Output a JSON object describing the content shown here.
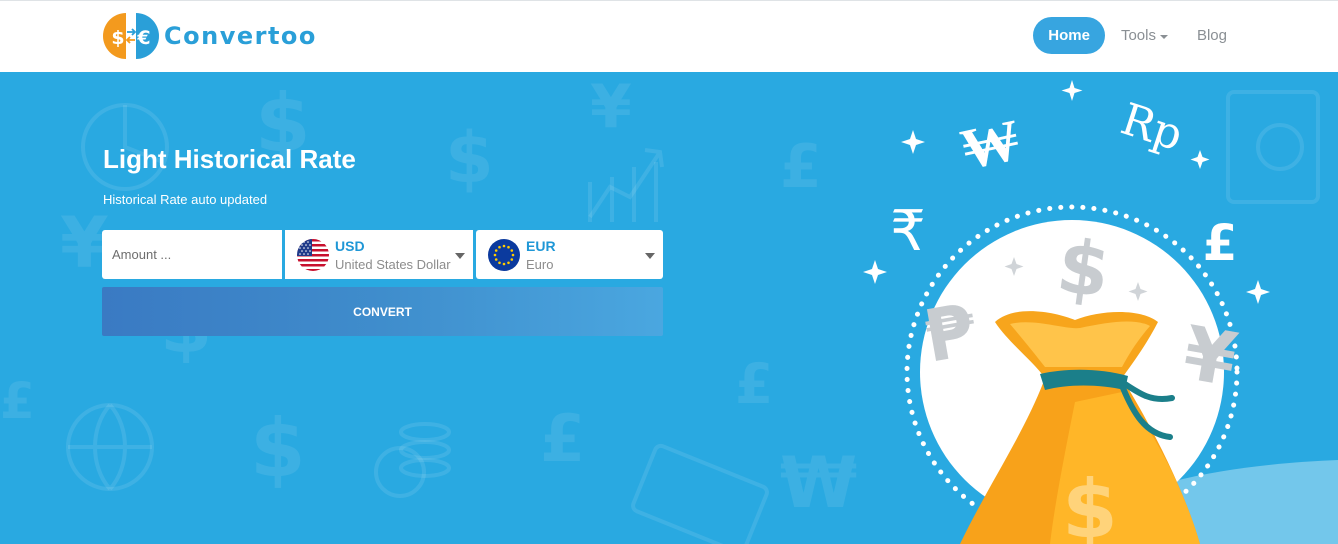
{
  "header": {
    "logo_text": "Convertoo",
    "logo_dollar": "$",
    "logo_euro": "€",
    "nav": [
      {
        "label": "Home",
        "active": true
      },
      {
        "label": "Tools",
        "active": false,
        "has_dropdown": true
      },
      {
        "label": "Blog",
        "active": false
      }
    ]
  },
  "hero": {
    "title": "Light Historical Rate",
    "subtitle": "Historical Rate auto updated"
  },
  "form": {
    "amount_placeholder": "Amount ...",
    "from": {
      "code": "USD",
      "name": "United States Dollar",
      "flag_icon": "us-flag-icon"
    },
    "to": {
      "code": "EUR",
      "name": "Euro",
      "flag_icon": "eu-flag-icon"
    },
    "convert_label": "CONVERT"
  },
  "illustration": {
    "symbols": [
      "₩",
      "Rp",
      "₹",
      "$",
      "£",
      "₱",
      "¥"
    ]
  },
  "colors": {
    "hero_bg": "#29a9e1",
    "accent": "#37a5e0",
    "logo_orange": "#f39a1e",
    "logo_blue": "#2a9fd8"
  }
}
